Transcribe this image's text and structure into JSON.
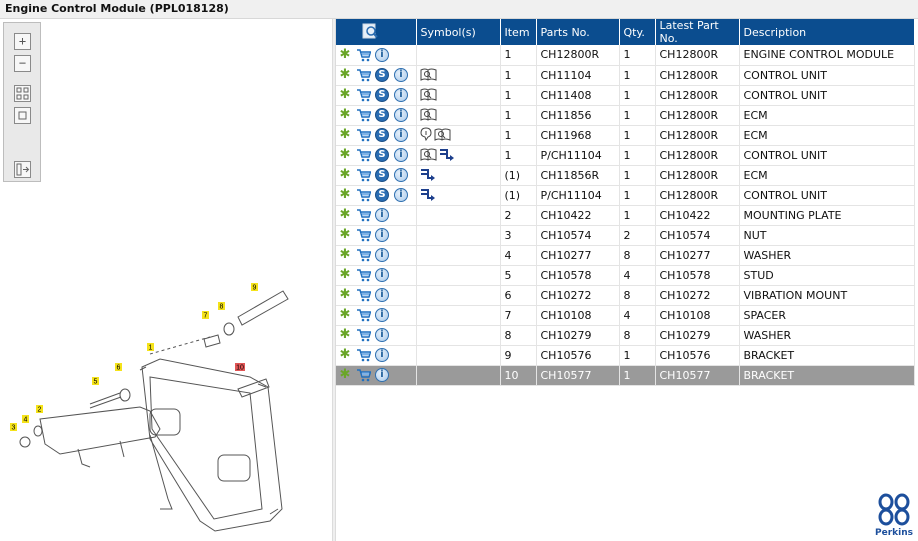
{
  "window": {
    "title": "Engine Control Module (PPL018128)"
  },
  "toolbox": {
    "tools": [
      {
        "name": "zoom-in",
        "glyph": "+"
      },
      {
        "name": "zoom-out",
        "glyph": "−"
      },
      {
        "name": "fit-all",
        "glyph": ""
      },
      {
        "name": "fit-window",
        "glyph": ""
      },
      {
        "name": "show-hotspots",
        "glyph": ""
      }
    ]
  },
  "diagram": {
    "callouts": [
      "1",
      "2",
      "3",
      "4",
      "5",
      "6",
      "7",
      "8",
      "9",
      "10"
    ],
    "highlighted_callout": "10"
  },
  "parts_table": {
    "columns": {
      "symbols": "Symbol(s)",
      "item": "Item",
      "part_no": "Parts No.",
      "qty": "Qty.",
      "latest": "Latest Part No.",
      "description": "Description"
    },
    "rows": [
      {
        "icons": [
          "gear",
          "cart",
          "info"
        ],
        "symbols": [],
        "item": "1",
        "part_no": "CH12800R",
        "qty": "1",
        "latest": "CH12800R",
        "description": "ENGINE CONTROL MODULE"
      },
      {
        "icons": [
          "gear",
          "cart",
          "s",
          "info"
        ],
        "symbols": [
          "book"
        ],
        "item": "1",
        "part_no": "CH11104",
        "qty": "1",
        "latest": "CH12800R",
        "description": "CONTROL UNIT"
      },
      {
        "icons": [
          "gear",
          "cart",
          "s",
          "info"
        ],
        "symbols": [
          "book"
        ],
        "item": "1",
        "part_no": "CH11408",
        "qty": "1",
        "latest": "CH12800R",
        "description": "CONTROL UNIT"
      },
      {
        "icons": [
          "gear",
          "cart",
          "s",
          "info"
        ],
        "symbols": [
          "book"
        ],
        "item": "1",
        "part_no": "CH11856",
        "qty": "1",
        "latest": "CH12800R",
        "description": "ECM"
      },
      {
        "icons": [
          "gear",
          "cart",
          "s",
          "info"
        ],
        "symbols": [
          "tip",
          "book"
        ],
        "item": "1",
        "part_no": "CH11968",
        "qty": "1",
        "latest": "CH12800R",
        "description": "ECM"
      },
      {
        "icons": [
          "gear",
          "cart",
          "s",
          "info"
        ],
        "symbols": [
          "book",
          "supersede"
        ],
        "item": "1",
        "part_no": "P/CH11104",
        "qty": "1",
        "latest": "CH12800R",
        "description": "CONTROL UNIT"
      },
      {
        "icons": [
          "gear",
          "cart",
          "s",
          "info"
        ],
        "symbols": [
          "supersede"
        ],
        "item": "(1)",
        "part_no": "CH11856R",
        "qty": "1",
        "latest": "CH12800R",
        "description": "ECM"
      },
      {
        "icons": [
          "gear",
          "cart",
          "s",
          "info"
        ],
        "symbols": [
          "supersede"
        ],
        "item": "(1)",
        "part_no": "P/CH11104",
        "qty": "1",
        "latest": "CH12800R",
        "description": "CONTROL UNIT"
      },
      {
        "icons": [
          "gear",
          "cart",
          "info"
        ],
        "symbols": [],
        "item": "2",
        "part_no": "CH10422",
        "qty": "1",
        "latest": "CH10422",
        "description": "MOUNTING PLATE"
      },
      {
        "icons": [
          "gear",
          "cart",
          "info"
        ],
        "symbols": [],
        "item": "3",
        "part_no": "CH10574",
        "qty": "2",
        "latest": "CH10574",
        "description": "NUT"
      },
      {
        "icons": [
          "gear",
          "cart",
          "info"
        ],
        "symbols": [],
        "item": "4",
        "part_no": "CH10277",
        "qty": "8",
        "latest": "CH10277",
        "description": "WASHER"
      },
      {
        "icons": [
          "gear",
          "cart",
          "info"
        ],
        "symbols": [],
        "item": "5",
        "part_no": "CH10578",
        "qty": "4",
        "latest": "CH10578",
        "description": "STUD"
      },
      {
        "icons": [
          "gear",
          "cart",
          "info"
        ],
        "symbols": [],
        "item": "6",
        "part_no": "CH10272",
        "qty": "8",
        "latest": "CH10272",
        "description": "VIBRATION MOUNT"
      },
      {
        "icons": [
          "gear",
          "cart",
          "info"
        ],
        "symbols": [],
        "item": "7",
        "part_no": "CH10108",
        "qty": "4",
        "latest": "CH10108",
        "description": "SPACER"
      },
      {
        "icons": [
          "gear",
          "cart",
          "info"
        ],
        "symbols": [],
        "item": "8",
        "part_no": "CH10279",
        "qty": "8",
        "latest": "CH10279",
        "description": "WASHER"
      },
      {
        "icons": [
          "gear",
          "cart",
          "info"
        ],
        "symbols": [],
        "item": "9",
        "part_no": "CH10576",
        "qty": "1",
        "latest": "CH10576",
        "description": "BRACKET"
      },
      {
        "icons": [
          "gear",
          "cart",
          "info"
        ],
        "symbols": [],
        "item": "10",
        "part_no": "CH10577",
        "qty": "1",
        "latest": "CH10577",
        "description": "BRACKET",
        "selected": true
      }
    ]
  },
  "brand": {
    "name": "Perkins",
    "color": "#1d4f9c"
  },
  "colors": {
    "header": "#0b4d8f",
    "selected_row": "#9a9a9a",
    "gear": "#6aa629",
    "callout": "#f5e31a",
    "callout_highlight": "#e05555"
  }
}
